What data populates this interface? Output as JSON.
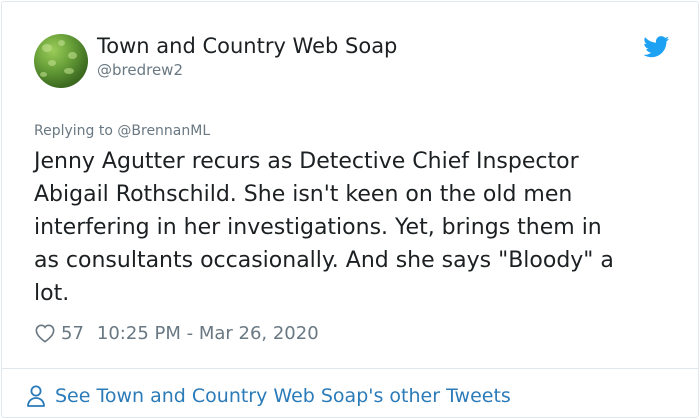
{
  "author": {
    "name": "Town and Country Web Soap",
    "handle": "@bredrew2",
    "avatar_icon": "avatar-image"
  },
  "reply_context": {
    "prefix": "Replying to ",
    "to": "@BrennanML"
  },
  "tweet": {
    "text": "Jenny Agutter recurs as Detective Chief Inspector\nAbigail Rothschild. She isn't keen on the old men\ninterfering in her investigations. Yet, brings them in\nas consultants occasionally. And she says \"Bloody\" a\nlot.",
    "likes": "57",
    "timestamp": "10:25 PM - Mar 26, 2020"
  },
  "footer": {
    "more_tweets_label": "See Town and Country Web Soap's other Tweets"
  },
  "icons": {
    "bird": "twitter-bird-icon",
    "heart": "heart-icon",
    "person": "person-icon"
  },
  "colors": {
    "twitter_blue": "#1da1f2",
    "link_blue": "#2b7bb9",
    "secondary_text": "#697882",
    "primary_text": "#1c2022",
    "border": "#e1e8ed"
  }
}
